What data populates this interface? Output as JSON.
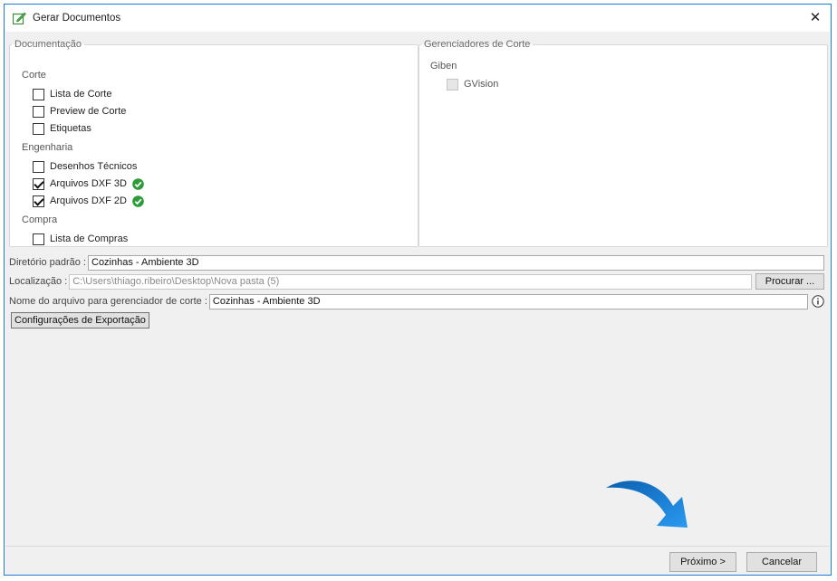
{
  "window": {
    "title": "Gerar Documentos",
    "close_glyph": "✕",
    "title_icon": "document-edit-icon"
  },
  "documentacao": {
    "legend": "Documentação",
    "groups": [
      {
        "label": "Corte",
        "items": [
          {
            "label": "Lista de Corte",
            "checked": false
          },
          {
            "label": "Preview de Corte",
            "checked": false
          },
          {
            "label": "Etiquetas",
            "checked": false
          }
        ]
      },
      {
        "label": "Engenharia",
        "items": [
          {
            "label": "Desenhos Técnicos",
            "checked": false
          },
          {
            "label": "Arquivos DXF 3D",
            "checked": true,
            "status_icon": "check-circle-icon"
          },
          {
            "label": "Arquivos DXF 2D",
            "checked": true,
            "status_icon": "check-circle-icon"
          }
        ]
      },
      {
        "label": "Compra",
        "items": [
          {
            "label": "Lista de Compras",
            "checked": false
          }
        ]
      }
    ]
  },
  "gerenciadores": {
    "legend": "Gerenciadores de Corte",
    "group_label": "Giben",
    "items": [
      {
        "label": "GVision",
        "checked": false,
        "disabled": true
      }
    ]
  },
  "form": {
    "diretorio_label": "Diretório padrão :",
    "diretorio_value": "Cozinhas - Ambiente 3D",
    "localizacao_label": "Localização :",
    "localizacao_value": "C:\\Users\\thiago.ribeiro\\Desktop\\Nova pasta (5)",
    "procurar_label": "Procurar ...",
    "nome_label": "Nome do arquivo para gerenciador de corte :",
    "nome_value": "Cozinhas - Ambiente 3D",
    "info_icon": "info-icon",
    "export_label": "Configurações de Exportação"
  },
  "footer": {
    "next_label": "Próximo >",
    "cancel_label": "Cancelar"
  },
  "colors": {
    "window_border": "#1e7ad6",
    "success": "#2e9b3a",
    "arrow": "#1f8fe0"
  }
}
